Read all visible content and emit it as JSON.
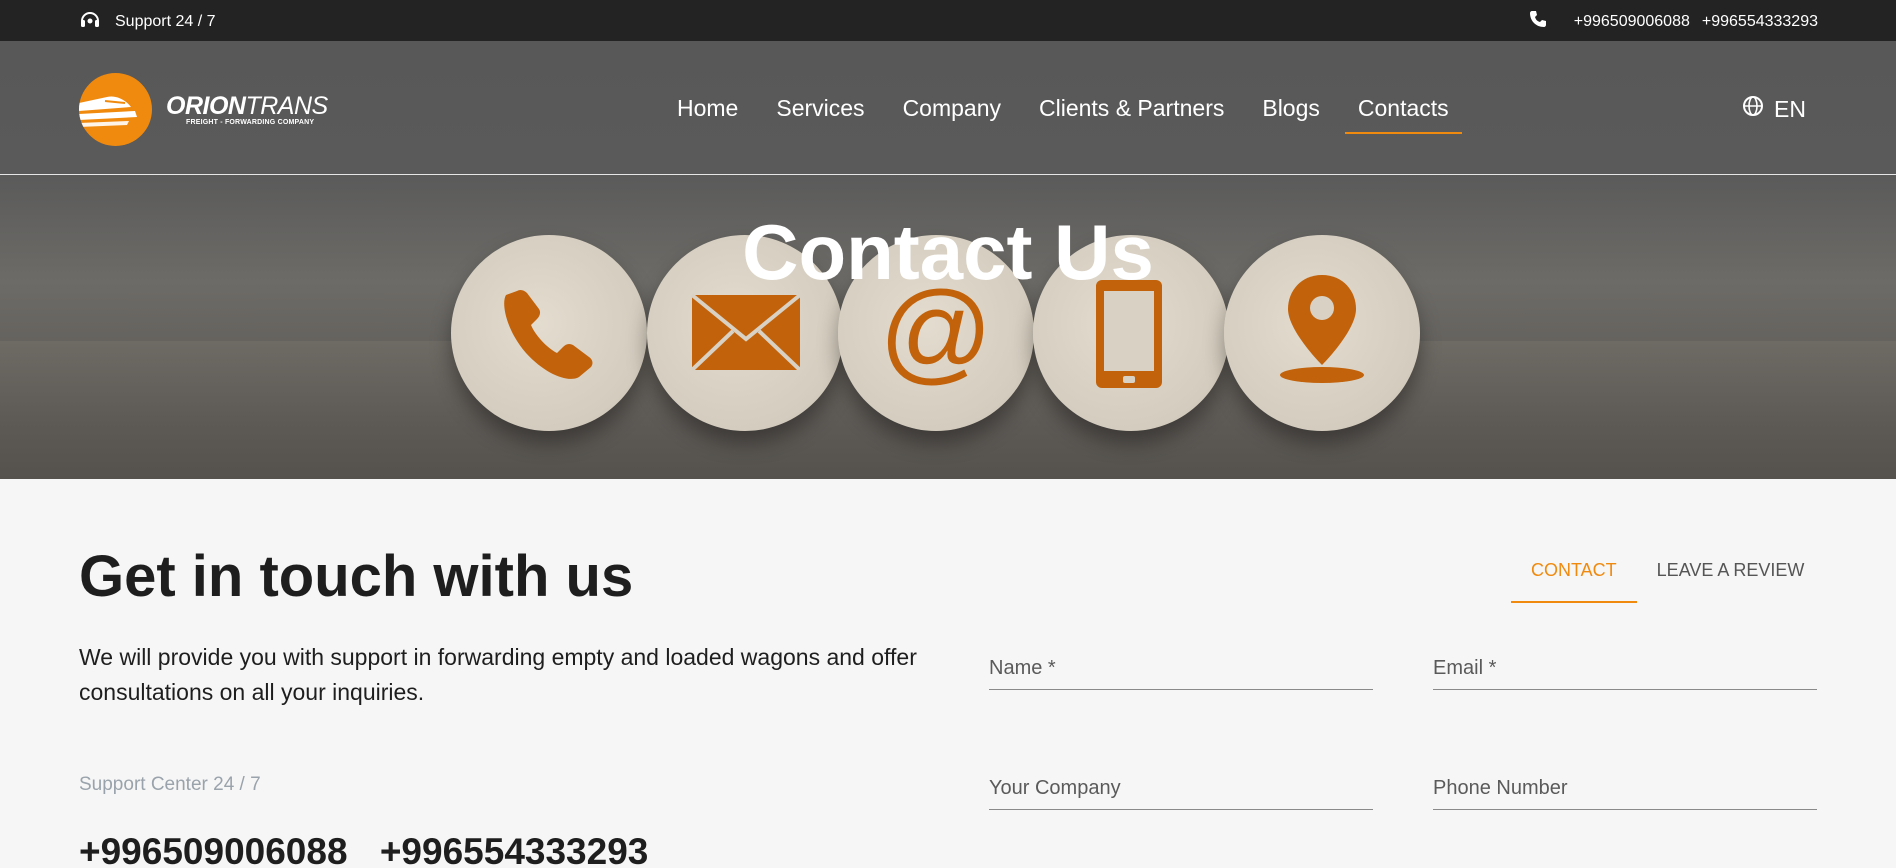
{
  "topbar": {
    "support_text": "Support 24 / 7",
    "phones": [
      "+996509006088",
      "+996554333293"
    ]
  },
  "header": {
    "logo": {
      "brand_bold": "ORION",
      "brand_light": "TRANS",
      "tagline": "FREIGHT - FORWARDING COMPANY"
    },
    "nav": [
      {
        "label": "Home",
        "active": false
      },
      {
        "label": "Services",
        "active": false
      },
      {
        "label": "Company",
        "active": false
      },
      {
        "label": "Clients & Partners",
        "active": false
      },
      {
        "label": "Blogs",
        "active": false
      },
      {
        "label": "Contacts",
        "active": true
      }
    ],
    "language": "EN"
  },
  "hero": {
    "title": "Contact Us",
    "icons": [
      "phone-icon",
      "envelope-icon",
      "at-sign-icon",
      "smartphone-icon",
      "location-pin-icon"
    ]
  },
  "content": {
    "title": "Get in touch with us",
    "description": "We will provide you with support in forwarding empty and loaded wagons and offer consultations on all your inquiries.",
    "support_label": "Support Center 24 / 7",
    "phones": [
      "+996509006088",
      "+996554333293"
    ]
  },
  "tabs": [
    {
      "label": "CONTACT",
      "active": true
    },
    {
      "label": "LEAVE A REVIEW",
      "active": false
    }
  ],
  "form": {
    "name_placeholder": "Name *",
    "email_placeholder": "Email *",
    "company_placeholder": "Your Company",
    "phone_placeholder": "Phone Number"
  },
  "colors": {
    "accent": "#f08a0f",
    "topbar_bg": "#232323",
    "page_bg": "#f6f6f6",
    "muted_text": "#9aa3ab"
  }
}
